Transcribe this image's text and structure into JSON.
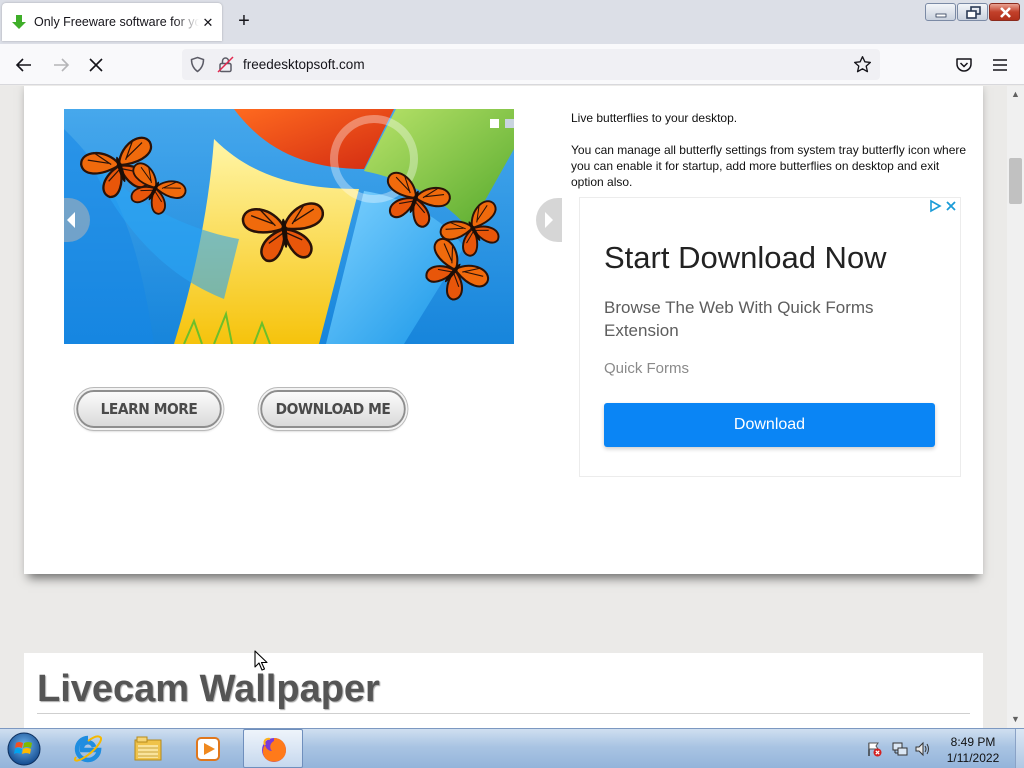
{
  "browser": {
    "tab_title": "Only Freeware software for your",
    "address": "freedesktopsoft.com"
  },
  "product": {
    "description_line1": "Live butterflies to your desktop.",
    "description_line2": "You can manage all butterfly settings from system tray butterfly icon where you can enable it for startup, add more butterflies on desktop and exit option also.",
    "learn_more_label": "LEARN MORE",
    "download_me_label": "DOWNLOAD ME",
    "slide_count": 2,
    "active_slide": 1
  },
  "ad": {
    "headline": "Start Download Now",
    "subline": "Browse The Web With Quick Forms Extension",
    "brand": "Quick Forms",
    "button_label": "Download",
    "button_color": "#0a85f5"
  },
  "next_section": {
    "title": "Livecam Wallpaper"
  },
  "taskbar": {
    "apps": [
      "internet-explorer-icon",
      "windows-explorer-icon",
      "media-player-icon",
      "firefox-icon"
    ],
    "active_app": "firefox-icon",
    "time": "8:49 PM",
    "date": "1/11/2022"
  }
}
